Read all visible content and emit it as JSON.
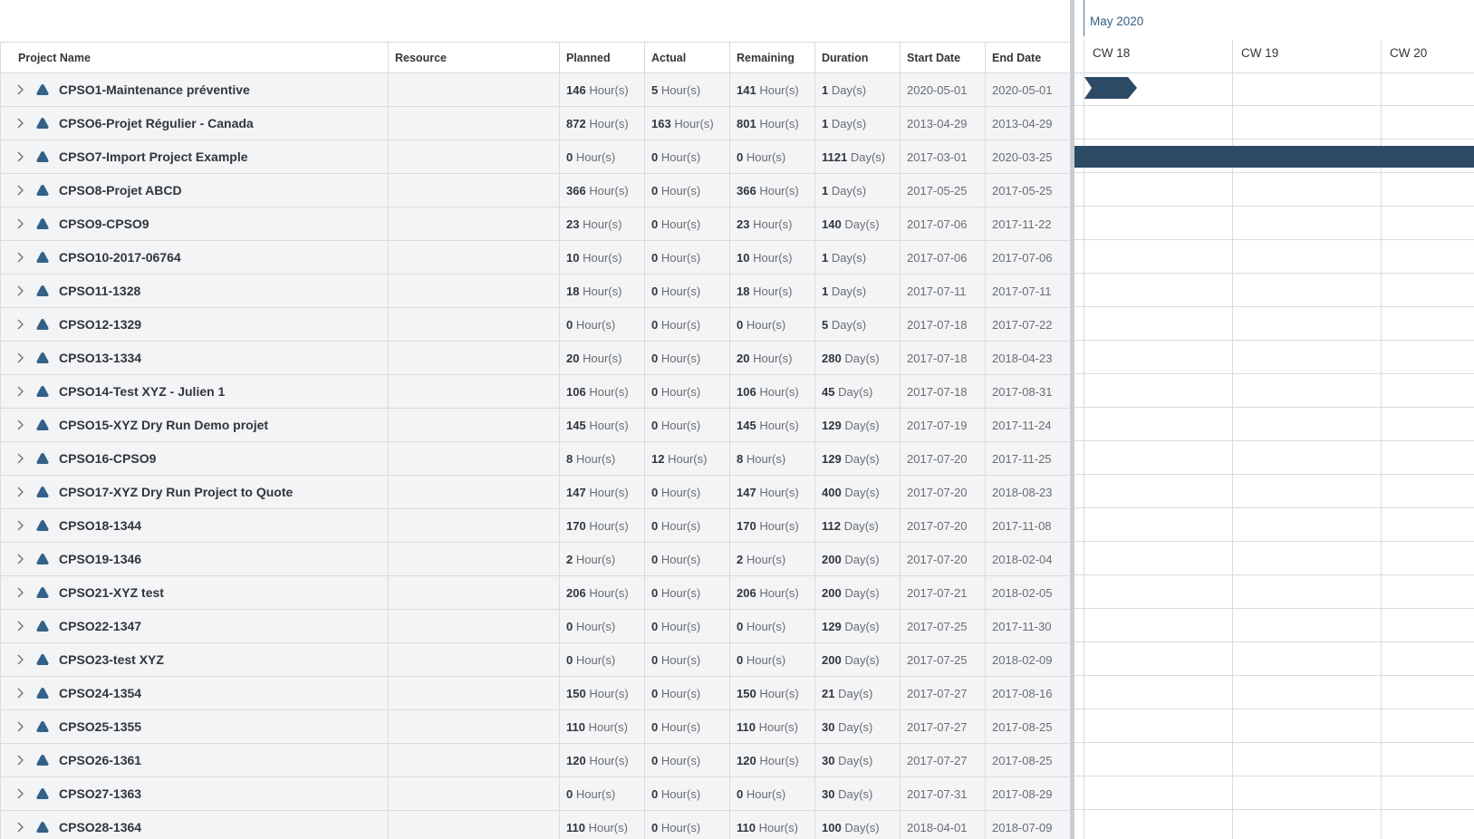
{
  "columns": {
    "name": "Project Name",
    "resource": "Resource",
    "planned": "Planned",
    "actual": "Actual",
    "remaining": "Remaining",
    "duration": "Duration",
    "start": "Start Date",
    "end": "End Date"
  },
  "units": {
    "hours": "Hour(s)",
    "days": "Day(s)"
  },
  "gantt": {
    "month": "May 2020",
    "weeks": [
      "CW 18",
      "CW 19",
      "CW 20"
    ],
    "bar_color": "#2d4a64"
  },
  "colors": {
    "accent": "#346187",
    "row_bg": "#f2f4f6",
    "grid": "#d8dadc"
  },
  "rows": [
    {
      "name": "CPSO1-Maintenance préventive",
      "planned": "146",
      "actual": "5",
      "remaining": "141",
      "duration": "1",
      "start": "2020-05-01",
      "end": "2020-05-01"
    },
    {
      "name": "CPSO6-Projet Régulier - Canada",
      "planned": "872",
      "actual": "163",
      "remaining": "801",
      "duration": "1",
      "start": "2013-04-29",
      "end": "2013-04-29"
    },
    {
      "name": "CPSO7-Import Project Example",
      "planned": "0",
      "actual": "0",
      "remaining": "0",
      "duration": "1121",
      "start": "2017-03-01",
      "end": "2020-03-25"
    },
    {
      "name": "CPSO8-Projet ABCD",
      "planned": "366",
      "actual": "0",
      "remaining": "366",
      "duration": "1",
      "start": "2017-05-25",
      "end": "2017-05-25"
    },
    {
      "name": "CPSO9-CPSO9",
      "planned": "23",
      "actual": "0",
      "remaining": "23",
      "duration": "140",
      "start": "2017-07-06",
      "end": "2017-11-22"
    },
    {
      "name": "CPSO10-2017-06764",
      "planned": "10",
      "actual": "0",
      "remaining": "10",
      "duration": "1",
      "start": "2017-07-06",
      "end": "2017-07-06"
    },
    {
      "name": "CPSO11-1328",
      "planned": "18",
      "actual": "0",
      "remaining": "18",
      "duration": "1",
      "start": "2017-07-11",
      "end": "2017-07-11"
    },
    {
      "name": "CPSO12-1329",
      "planned": "0",
      "actual": "0",
      "remaining": "0",
      "duration": "5",
      "start": "2017-07-18",
      "end": "2017-07-22"
    },
    {
      "name": "CPSO13-1334",
      "planned": "20",
      "actual": "0",
      "remaining": "20",
      "duration": "280",
      "start": "2017-07-18",
      "end": "2018-04-23"
    },
    {
      "name": "CPSO14-Test XYZ - Julien 1",
      "planned": "106",
      "actual": "0",
      "remaining": "106",
      "duration": "45",
      "start": "2017-07-18",
      "end": "2017-08-31"
    },
    {
      "name": "CPSO15-XYZ Dry Run Demo projet",
      "planned": "145",
      "actual": "0",
      "remaining": "145",
      "duration": "129",
      "start": "2017-07-19",
      "end": "2017-11-24"
    },
    {
      "name": "CPSO16-CPSO9",
      "planned": "8",
      "actual": "12",
      "remaining": "8",
      "duration": "129",
      "start": "2017-07-20",
      "end": "2017-11-25"
    },
    {
      "name": "CPSO17-XYZ Dry Run Project to Quote",
      "planned": "147",
      "actual": "0",
      "remaining": "147",
      "duration": "400",
      "start": "2017-07-20",
      "end": "2018-08-23"
    },
    {
      "name": "CPSO18-1344",
      "planned": "170",
      "actual": "0",
      "remaining": "170",
      "duration": "112",
      "start": "2017-07-20",
      "end": "2017-11-08"
    },
    {
      "name": "CPSO19-1346",
      "planned": "2",
      "actual": "0",
      "remaining": "2",
      "duration": "200",
      "start": "2017-07-20",
      "end": "2018-02-04"
    },
    {
      "name": "CPSO21-XYZ test",
      "planned": "206",
      "actual": "0",
      "remaining": "206",
      "duration": "200",
      "start": "2017-07-21",
      "end": "2018-02-05"
    },
    {
      "name": "CPSO22-1347",
      "planned": "0",
      "actual": "0",
      "remaining": "0",
      "duration": "129",
      "start": "2017-07-25",
      "end": "2017-11-30"
    },
    {
      "name": "CPSO23-test XYZ",
      "planned": "0",
      "actual": "0",
      "remaining": "0",
      "duration": "200",
      "start": "2017-07-25",
      "end": "2018-02-09"
    },
    {
      "name": "CPSO24-1354",
      "planned": "150",
      "actual": "0",
      "remaining": "150",
      "duration": "21",
      "start": "2017-07-27",
      "end": "2017-08-16"
    },
    {
      "name": "CPSO25-1355",
      "planned": "110",
      "actual": "0",
      "remaining": "110",
      "duration": "30",
      "start": "2017-07-27",
      "end": "2017-08-25"
    },
    {
      "name": "CPSO26-1361",
      "planned": "120",
      "actual": "0",
      "remaining": "120",
      "duration": "30",
      "start": "2017-07-27",
      "end": "2017-08-25"
    },
    {
      "name": "CPSO27-1363",
      "planned": "0",
      "actual": "0",
      "remaining": "0",
      "duration": "30",
      "start": "2017-07-31",
      "end": "2017-08-29"
    },
    {
      "name": "CPSO28-1364",
      "planned": "110",
      "actual": "0",
      "remaining": "110",
      "duration": "100",
      "start": "2018-04-01",
      "end": "2018-07-09"
    }
  ]
}
